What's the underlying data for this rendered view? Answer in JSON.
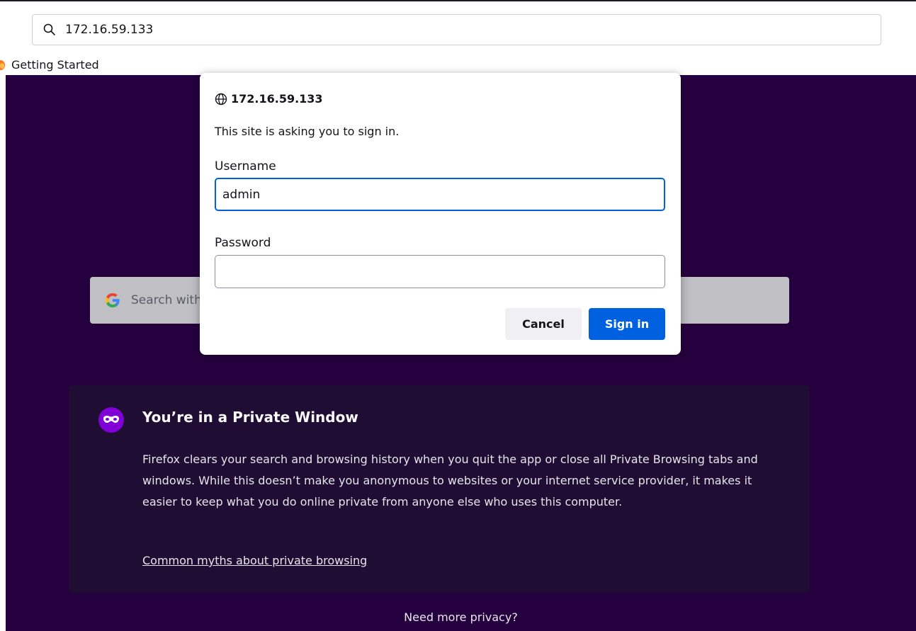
{
  "browser": {
    "url": "172.16.59.133",
    "bookmarks": [
      {
        "label": "Getting Started",
        "icon": "firefox-icon"
      }
    ]
  },
  "newtab": {
    "search_placeholder": "Search with Google or enter address",
    "private": {
      "title": "You’re in a Private Window",
      "body": "Firefox clears your search and browsing history when you quit the app or close all Private Browsing tabs and windows. While this doesn’t make you anonymous to websites or your internet service provider, it makes it easier to keep what you do online private from anyone else who uses this computer.",
      "link": "Common myths about private browsing"
    },
    "footer": "Need more privacy?"
  },
  "auth_dialog": {
    "host": "172.16.59.133",
    "message": "This site is asking you to sign in.",
    "username_label": "Username",
    "username_value": "admin",
    "password_label": "Password",
    "password_value": "",
    "cancel_label": "Cancel",
    "signin_label": "Sign in"
  },
  "colors": {
    "accent": "#0061e0",
    "private_bg": "#25003e",
    "private_card": "#1f0d33",
    "private_icon": "#8000d7"
  }
}
